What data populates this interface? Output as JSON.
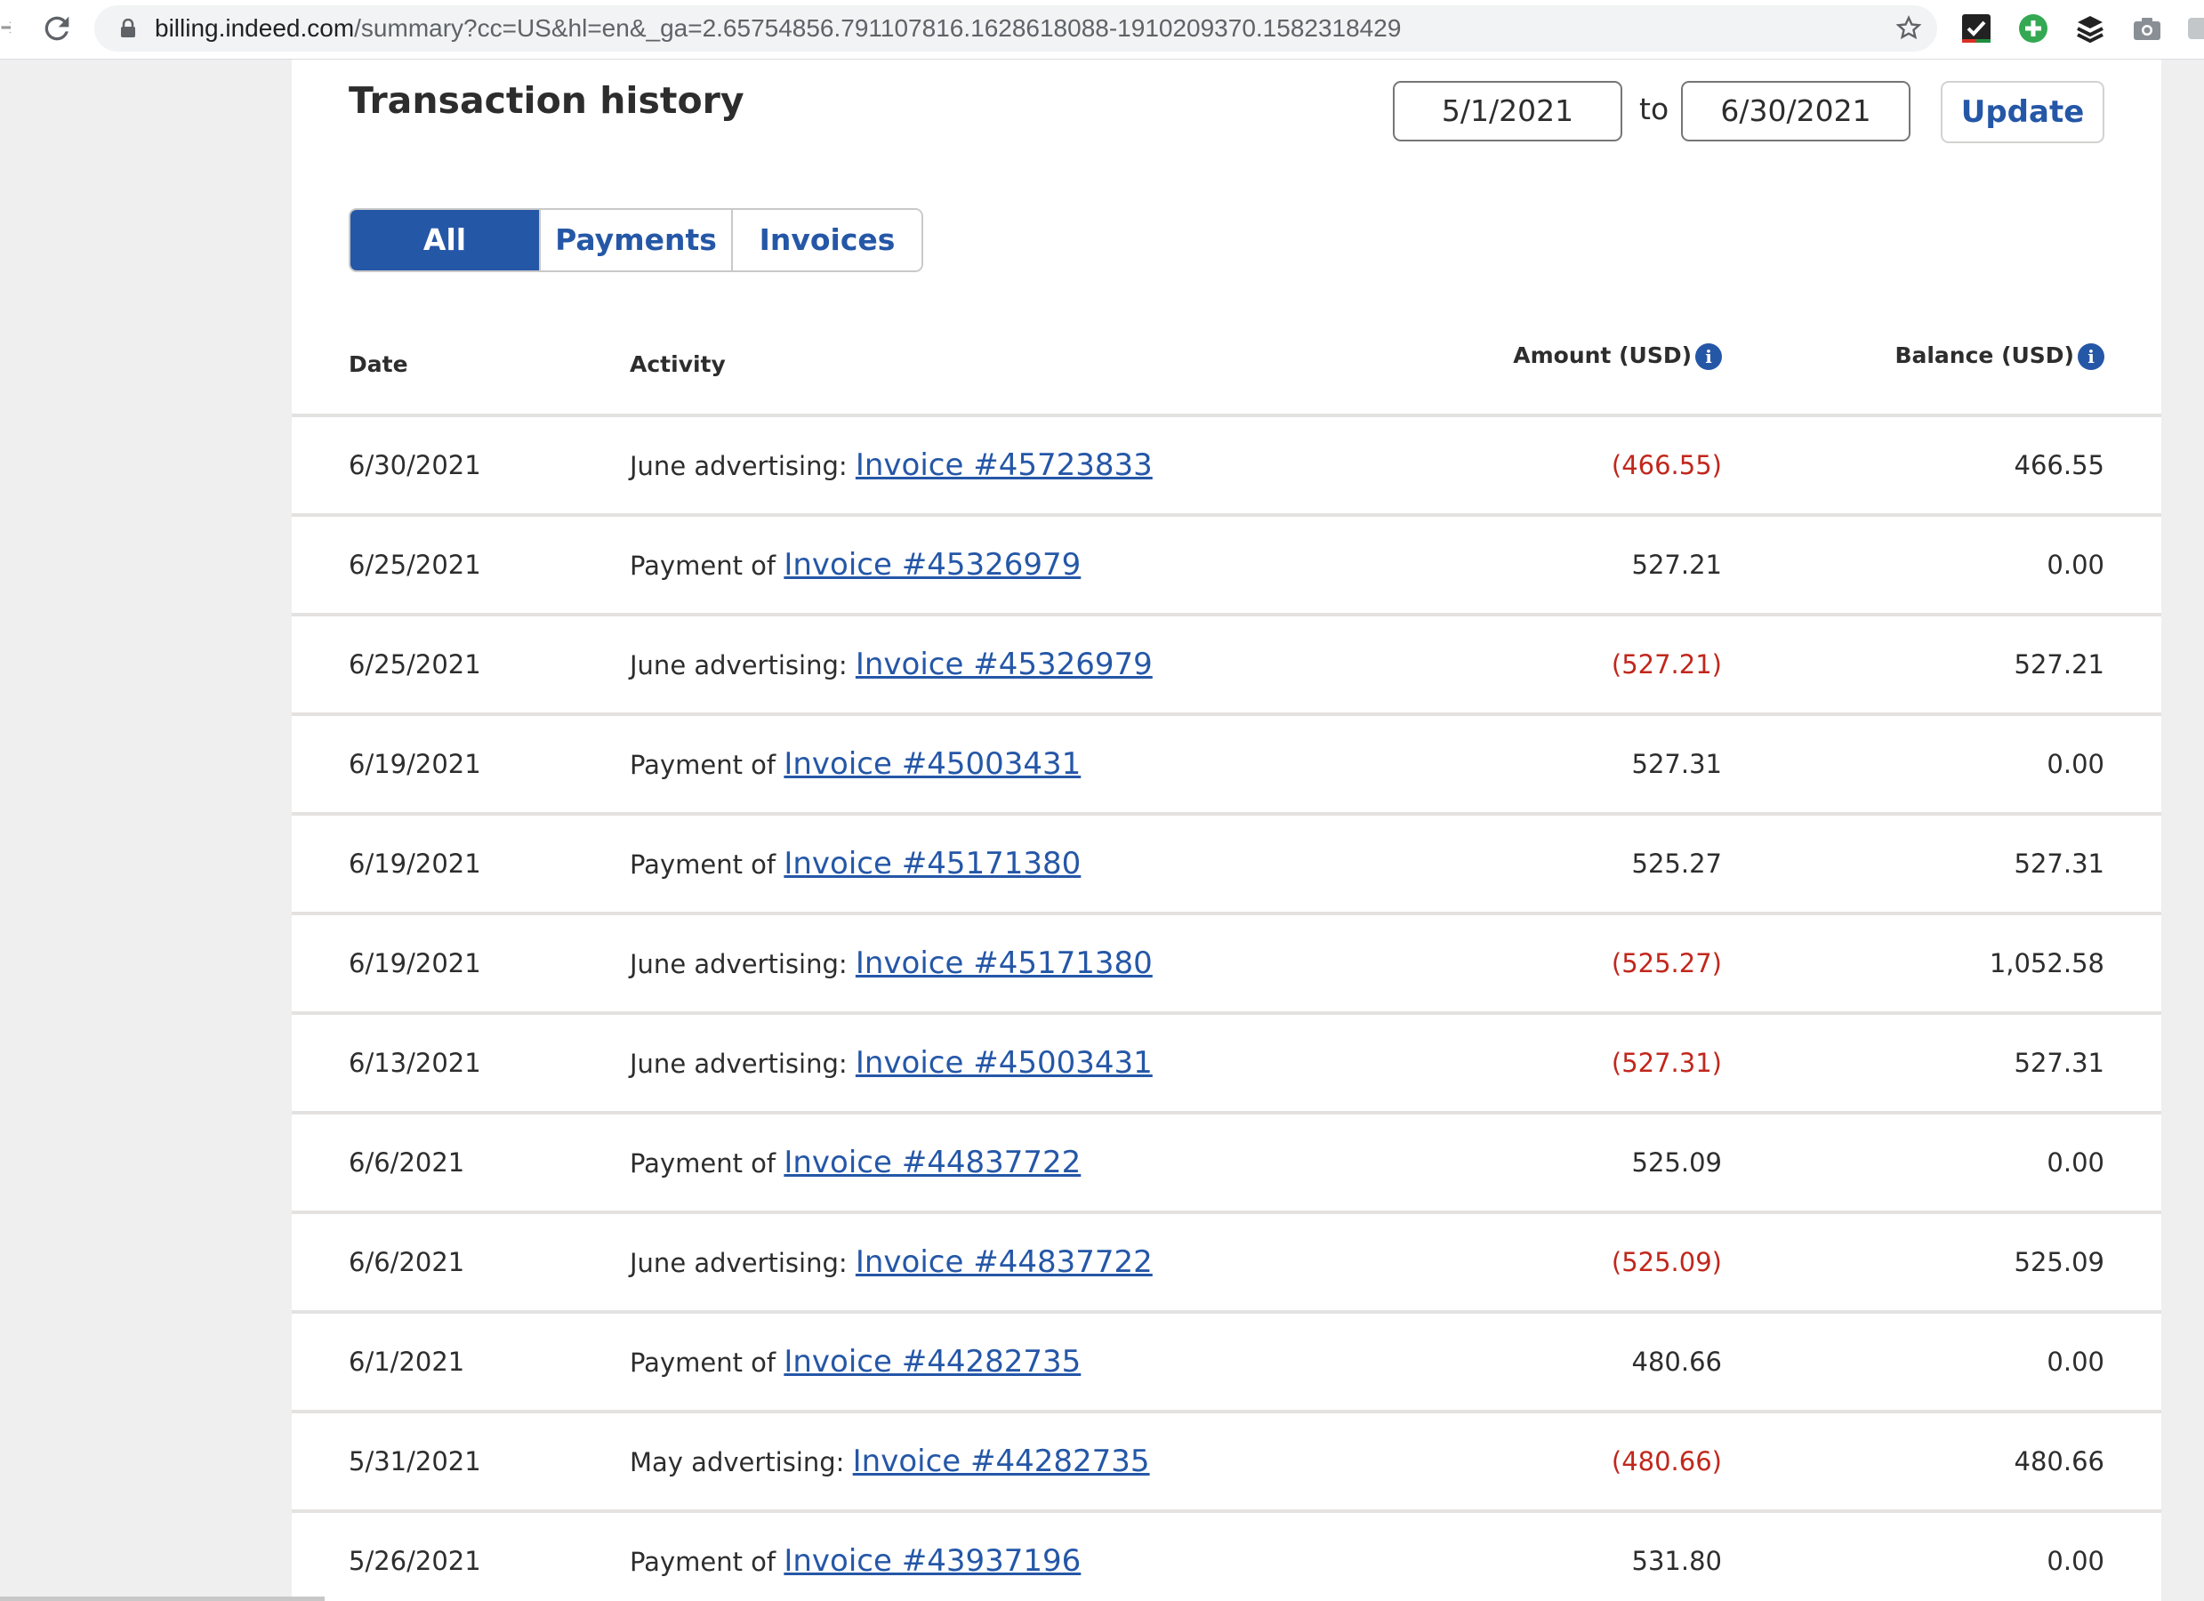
{
  "browser": {
    "url_host": "billing.indeed.com",
    "url_rest": "/summary?cc=US&hl=en&_ga=2.65754856.791107816.1628618088-1910209370.1582318429"
  },
  "page": {
    "title": "Transaction history",
    "date_from": "5/1/2021",
    "to_label": "to",
    "date_to": "6/30/2021",
    "update_label": "Update"
  },
  "tabs": [
    {
      "label": "All",
      "active": true
    },
    {
      "label": "Payments",
      "active": false
    },
    {
      "label": "Invoices",
      "active": false
    }
  ],
  "table": {
    "headers": {
      "date": "Date",
      "activity": "Activity",
      "amount": "Amount (USD)",
      "balance": "Balance (USD)"
    },
    "rows": [
      {
        "date": "6/30/2021",
        "prefix": "June advertising:",
        "invoice": "Invoice #45723833",
        "amount": "(466.55)",
        "negative": true,
        "balance": "466.55"
      },
      {
        "date": "6/25/2021",
        "prefix": "Payment of",
        "invoice": "Invoice #45326979",
        "amount": "527.21",
        "negative": false,
        "balance": "0.00"
      },
      {
        "date": "6/25/2021",
        "prefix": "June advertising:",
        "invoice": "Invoice #45326979",
        "amount": "(527.21)",
        "negative": true,
        "balance": "527.21"
      },
      {
        "date": "6/19/2021",
        "prefix": "Payment of",
        "invoice": "Invoice #45003431",
        "amount": "527.31",
        "negative": false,
        "balance": "0.00"
      },
      {
        "date": "6/19/2021",
        "prefix": "Payment of",
        "invoice": "Invoice #45171380",
        "amount": "525.27",
        "negative": false,
        "balance": "527.31"
      },
      {
        "date": "6/19/2021",
        "prefix": "June advertising:",
        "invoice": "Invoice #45171380",
        "amount": "(525.27)",
        "negative": true,
        "balance": "1,052.58"
      },
      {
        "date": "6/13/2021",
        "prefix": "June advertising:",
        "invoice": "Invoice #45003431",
        "amount": "(527.31)",
        "negative": true,
        "balance": "527.31"
      },
      {
        "date": "6/6/2021",
        "prefix": "Payment of",
        "invoice": "Invoice #44837722",
        "amount": "525.09",
        "negative": false,
        "balance": "0.00"
      },
      {
        "date": "6/6/2021",
        "prefix": "June advertising:",
        "invoice": "Invoice #44837722",
        "amount": "(525.09)",
        "negative": true,
        "balance": "525.09"
      },
      {
        "date": "6/1/2021",
        "prefix": "Payment of",
        "invoice": "Invoice #44282735",
        "amount": "480.66",
        "negative": false,
        "balance": "0.00"
      },
      {
        "date": "5/31/2021",
        "prefix": "May advertising:",
        "invoice": "Invoice #44282735",
        "amount": "(480.66)",
        "negative": true,
        "balance": "480.66"
      },
      {
        "date": "5/26/2021",
        "prefix": "Payment of",
        "invoice": "Invoice #43937196",
        "amount": "531.80",
        "negative": false,
        "balance": "0.00"
      }
    ]
  },
  "colors": {
    "brand_blue": "#2557a7",
    "negative_red": "#c1271c"
  }
}
